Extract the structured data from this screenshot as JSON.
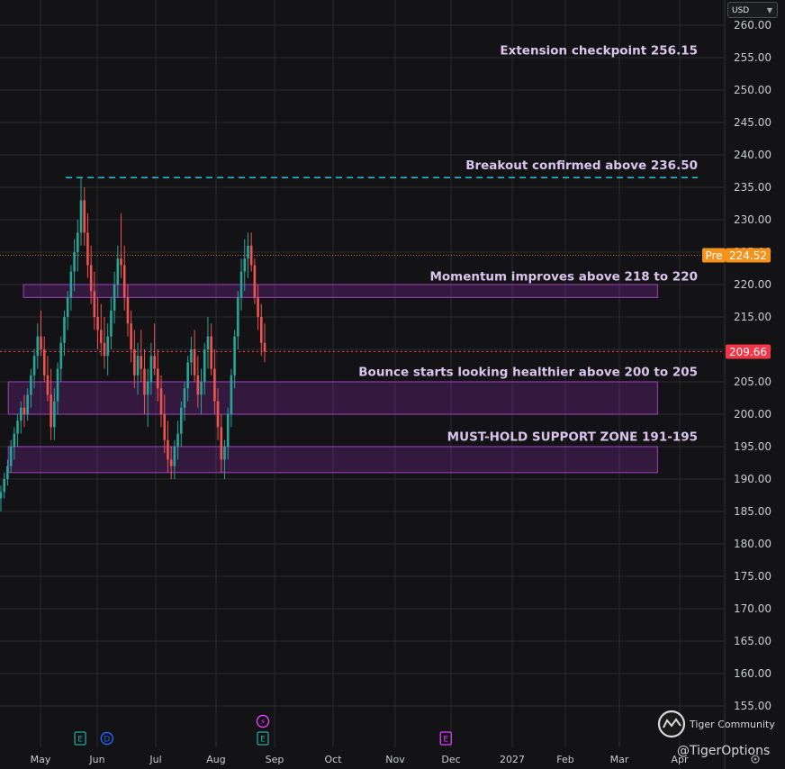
{
  "currency": {
    "label": "USD"
  },
  "chart_data": {
    "type": "candlestick",
    "y_axis": {
      "min": 152.5,
      "max": 262.5,
      "step": 5,
      "position": "right",
      "ticks": [
        "155.00",
        "160.00",
        "165.00",
        "170.00",
        "175.00",
        "180.00",
        "185.00",
        "190.00",
        "195.00",
        "200.00",
        "205.00",
        "210.00",
        "215.00",
        "220.00",
        "225.00",
        "230.00",
        "235.00",
        "240.00",
        "245.00",
        "250.00",
        "255.00",
        "260.00"
      ]
    },
    "x_axis": {
      "ticks": [
        "May",
        "Jun",
        "Jul",
        "Aug",
        "Sep",
        "Oct",
        "Nov",
        "Dec",
        "2027",
        "Feb",
        "Mar",
        "Apr"
      ]
    },
    "grid": true,
    "current_price": {
      "value": 209.66,
      "label": "209.66",
      "color": "#f23645"
    },
    "premarket": {
      "value": 224.52,
      "label": "224.52",
      "tag": "Pre",
      "color": "#f7931a"
    },
    "annotations": [
      {
        "text": "Extension checkpoint 256.15",
        "y": 256.15
      },
      {
        "text": "Breakout confirmed above 236.50",
        "y": 238.5
      },
      {
        "text": "Momentum improves above 218 to 220",
        "y": 221.3
      },
      {
        "text": "Bounce starts looking healthier above 200 to 205",
        "y": 206.6
      },
      {
        "text": "MUST-HOLD SUPPORT ZONE 191-195",
        "y": 196.6
      }
    ],
    "zones": [
      {
        "low": 218,
        "high": 220,
        "x_start": "Apr-22",
        "x_end": "Mar-20"
      },
      {
        "low": 200,
        "high": 205,
        "x_start": "Apr-14",
        "x_end": "Mar-20"
      },
      {
        "low": 191,
        "high": 195,
        "x_start": "Apr-14",
        "x_end": "Mar-20"
      }
    ],
    "breakout_line": {
      "value": 236.5,
      "color": "#26c6da"
    },
    "series": [
      {
        "values": [
          [
            187,
            189,
            185,
            188
          ],
          [
            188,
            191,
            187,
            190
          ],
          [
            190,
            193,
            189,
            192
          ],
          [
            192,
            196,
            191,
            195
          ],
          [
            195,
            198,
            193,
            197
          ],
          [
            197,
            200,
            195,
            199
          ],
          [
            199,
            202,
            197,
            201
          ],
          [
            201,
            203,
            198,
            200
          ],
          [
            200,
            204,
            199,
            203
          ],
          [
            203,
            207,
            201,
            206
          ],
          [
            206,
            210,
            204,
            209
          ],
          [
            209,
            214,
            207,
            212
          ],
          [
            212,
            216,
            209,
            210
          ],
          [
            210,
            212,
            205,
            206
          ],
          [
            206,
            209,
            202,
            203
          ],
          [
            203,
            207,
            196,
            198
          ],
          [
            198,
            204,
            196,
            202
          ],
          [
            202,
            208,
            200,
            207
          ],
          [
            207,
            212,
            205,
            211
          ],
          [
            211,
            216,
            209,
            215
          ],
          [
            215,
            219,
            213,
            218
          ],
          [
            218,
            223,
            216,
            222
          ],
          [
            222,
            227,
            219,
            225
          ],
          [
            225,
            230,
            222,
            228
          ],
          [
            228,
            236.5,
            226,
            233
          ],
          [
            233,
            235,
            226,
            228
          ],
          [
            228,
            231,
            221,
            223
          ],
          [
            223,
            226,
            217,
            219
          ],
          [
            219,
            222,
            213,
            215
          ],
          [
            215,
            218,
            210,
            213
          ],
          [
            213,
            217,
            209,
            211
          ],
          [
            211,
            215,
            207,
            209
          ],
          [
            209,
            214,
            206,
            212
          ],
          [
            212,
            218,
            210,
            216
          ],
          [
            216,
            222,
            214,
            220
          ],
          [
            220,
            226,
            218,
            224
          ],
          [
            224,
            231,
            221,
            223
          ],
          [
            223,
            226,
            216,
            218
          ],
          [
            218,
            220,
            212,
            214
          ],
          [
            214,
            216,
            208,
            210
          ],
          [
            210,
            213,
            204,
            206
          ],
          [
            206,
            211,
            203,
            209
          ],
          [
            209,
            213,
            205,
            207
          ],
          [
            207,
            210,
            200,
            203
          ],
          [
            203,
            207,
            198,
            205
          ],
          [
            205,
            211,
            203,
            209
          ],
          [
            209,
            214,
            206,
            207
          ],
          [
            207,
            210,
            202,
            204
          ],
          [
            204,
            206,
            198,
            200
          ],
          [
            200,
            203,
            194,
            196
          ],
          [
            196,
            199,
            191,
            193
          ],
          [
            193,
            195,
            190,
            192
          ],
          [
            192,
            196,
            190,
            195
          ],
          [
            195,
            199,
            193,
            197
          ],
          [
            197,
            202,
            195,
            201
          ],
          [
            201,
            205,
            199,
            204
          ],
          [
            204,
            209,
            202,
            208
          ],
          [
            208,
            212,
            206,
            210
          ],
          [
            210,
            213,
            205,
            206
          ],
          [
            206,
            209,
            201,
            203
          ],
          [
            203,
            207,
            200,
            205
          ],
          [
            205,
            211,
            203,
            210
          ],
          [
            210,
            215,
            207,
            212
          ],
          [
            212,
            214,
            206,
            207
          ],
          [
            207,
            210,
            200,
            202
          ],
          [
            202,
            204,
            196,
            198
          ],
          [
            198,
            200,
            191,
            193
          ],
          [
            193,
            196,
            190,
            195
          ],
          [
            195,
            201,
            193,
            200
          ],
          [
            200,
            207,
            198,
            206
          ],
          [
            206,
            213,
            204,
            212
          ],
          [
            212,
            219,
            210,
            218
          ],
          [
            218,
            224,
            216,
            222
          ],
          [
            222,
            227,
            219,
            224
          ],
          [
            224,
            228,
            221,
            226
          ],
          [
            226,
            228,
            222,
            223
          ],
          [
            223,
            224,
            217,
            218
          ],
          [
            218,
            220,
            213,
            215
          ],
          [
            215,
            217,
            209,
            211
          ],
          [
            211,
            214,
            208,
            209.66
          ]
        ]
      }
    ]
  },
  "markers": [
    {
      "symbol": "E",
      "date": "May-22",
      "color": "#26a69a"
    },
    {
      "symbol": "D",
      "date": "Jun-06",
      "color": "#2962ff"
    },
    {
      "symbol": "⚡",
      "date": "Aug-25",
      "color": "#e040fb"
    },
    {
      "symbol": "E",
      "date": "Aug-25",
      "color": "#26a69a"
    },
    {
      "symbol": "E",
      "date": "Dec-02",
      "color": "#e040fb"
    }
  ],
  "watermark": {
    "community": "Tiger Community",
    "handle": "@TigerOptions"
  }
}
